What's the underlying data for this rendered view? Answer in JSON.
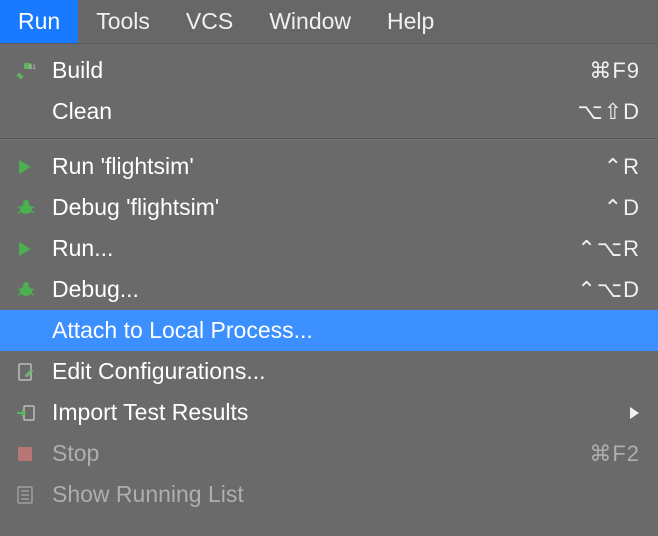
{
  "menubar": {
    "items": [
      {
        "label": "Run",
        "active": true
      },
      {
        "label": "Tools",
        "active": false
      },
      {
        "label": "VCS",
        "active": false
      },
      {
        "label": "Window",
        "active": false
      },
      {
        "label": "Help",
        "active": false
      }
    ]
  },
  "menu": {
    "build": {
      "label": "Build",
      "shortcut": "⌘F9"
    },
    "clean": {
      "label": "Clean",
      "shortcut": "⌥⇧D"
    },
    "run_target": {
      "label": "Run 'flightsim'",
      "shortcut": "⌃R"
    },
    "debug_target": {
      "label": "Debug 'flightsim'",
      "shortcut": "⌃D"
    },
    "run": {
      "label": "Run...",
      "shortcut": "⌃⌥R"
    },
    "debug": {
      "label": "Debug...",
      "shortcut": "⌃⌥D"
    },
    "attach": {
      "label": "Attach to Local Process..."
    },
    "edit_conf": {
      "label": "Edit Configurations..."
    },
    "import_tests": {
      "label": "Import Test Results"
    },
    "stop": {
      "label": "Stop",
      "shortcut": "⌘F2"
    },
    "show_running": {
      "label": "Show Running List"
    }
  }
}
